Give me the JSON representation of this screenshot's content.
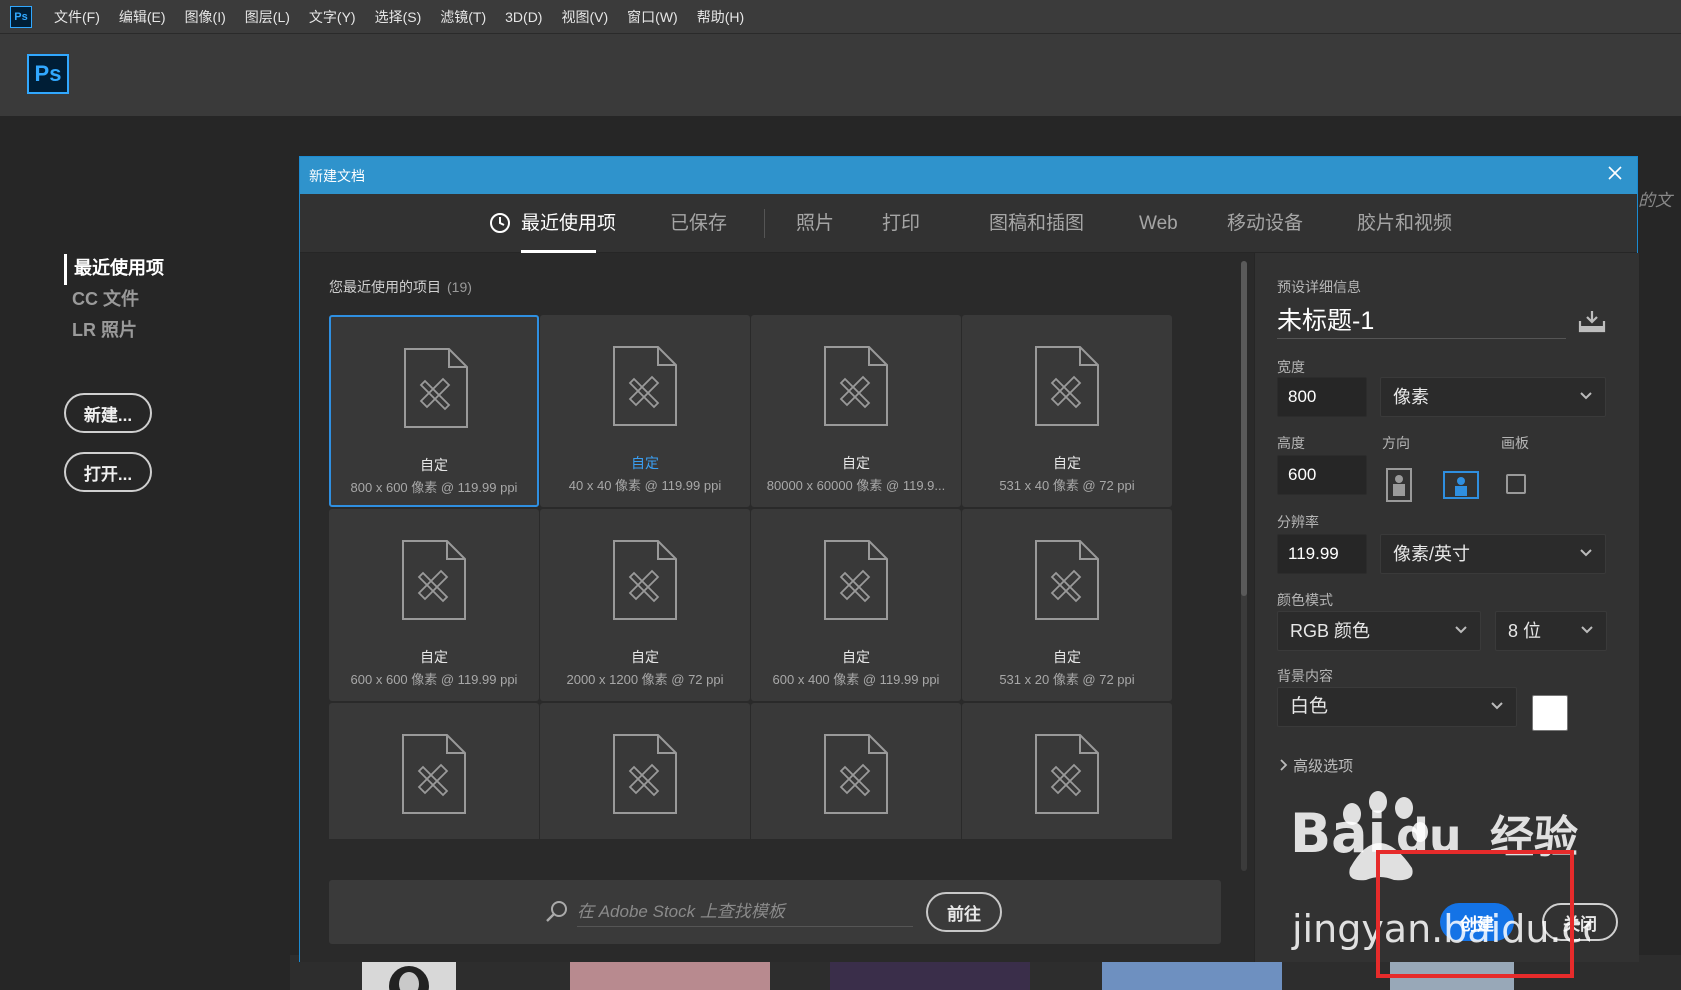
{
  "menubar": {
    "ps_badge": "Ps",
    "items": [
      "文件(F)",
      "编辑(E)",
      "图像(I)",
      "图层(L)",
      "文字(Y)",
      "选择(S)",
      "滤镜(T)",
      "3D(D)",
      "视图(V)",
      "窗口(W)",
      "帮助(H)"
    ]
  },
  "app": {
    "logo": "Ps"
  },
  "home": {
    "nav": [
      "最近使用项",
      "CC 文件",
      "LR 照片"
    ],
    "new_button": "新建...",
    "open_button": "打开...",
    "bg_hint": "的文"
  },
  "dialog": {
    "title": "新建文档",
    "tabs": [
      "最近使用项",
      "已保存",
      "照片",
      "打印",
      "图稿和插图",
      "Web",
      "移动设备",
      "胶片和视频"
    ],
    "recent_title": "您最近使用的项目",
    "recent_count": "(19)",
    "cards": [
      {
        "name": "自定",
        "meta": "800 x 600 像素 @ 119.99 ppi",
        "selected": true
      },
      {
        "name": "自定",
        "meta": "40 x 40 像素 @ 119.99 ppi",
        "highlight": true
      },
      {
        "name": "自定",
        "meta": "80000 x 60000 像素 @ 119.9..."
      },
      {
        "name": "自定",
        "meta": "531 x 40 像素 @ 72 ppi"
      },
      {
        "name": "自定",
        "meta": "600 x 600 像素 @ 119.99 ppi"
      },
      {
        "name": "自定",
        "meta": "2000 x 1200 像素 @ 72 ppi"
      },
      {
        "name": "自定",
        "meta": "600 x 400 像素 @ 119.99 ppi"
      },
      {
        "name": "自定",
        "meta": "531 x 20 像素 @ 72 ppi"
      }
    ],
    "stock": {
      "placeholder": "在 Adobe Stock 上查找模板",
      "go_button": "前往"
    },
    "preset": {
      "section_label": "预设详细信息",
      "doc_name": "未标题-1",
      "width_label": "宽度",
      "width_value": "800",
      "width_unit": "像素",
      "height_label": "高度",
      "height_value": "600",
      "orientation_label": "方向",
      "artboard_label": "画板",
      "resolution_label": "分辨率",
      "resolution_value": "119.99",
      "resolution_unit": "像素/英寸",
      "color_mode_label": "颜色模式",
      "color_mode": "RGB 颜色",
      "bit_depth": "8 位",
      "background_label": "背景内容",
      "background": "白色",
      "advanced": "高级选项",
      "create_button": "创建",
      "close_button": "关闭"
    }
  },
  "watermark": {
    "brand": "Bai",
    "brand_du": "du",
    "brand_cn": "经验",
    "url": "jingyan.baidu.com"
  },
  "colors": {
    "accent": "#2f93cc",
    "create_blue": "#1473e6",
    "highlight_box": "#e62b2b"
  }
}
